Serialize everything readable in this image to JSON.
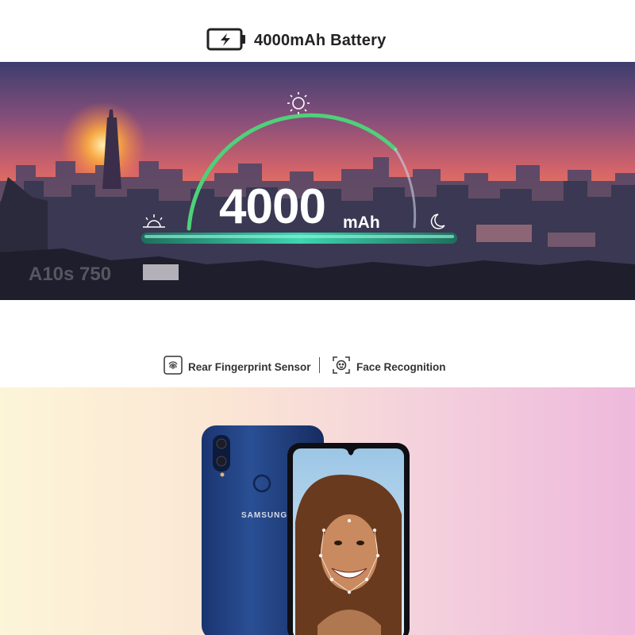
{
  "battery_header": {
    "title": "4000mAh Battery",
    "icon": "battery-charging-icon"
  },
  "banner": {
    "capacity_value": "4000",
    "capacity_unit": "mAh",
    "model_watermark": "A10s 750",
    "icons": [
      "sun-icon",
      "sunrise-icon",
      "moon-icon"
    ],
    "arc_color": "#4fd07a"
  },
  "security": {
    "features": [
      {
        "label": "Rear Fingerprint Sensor",
        "icon": "fingerprint-icon"
      },
      {
        "label": "Face Recognition",
        "icon": "face-scan-icon"
      }
    ]
  },
  "phone": {
    "brand": "SAMSUNG",
    "color": "#1e3c78"
  }
}
